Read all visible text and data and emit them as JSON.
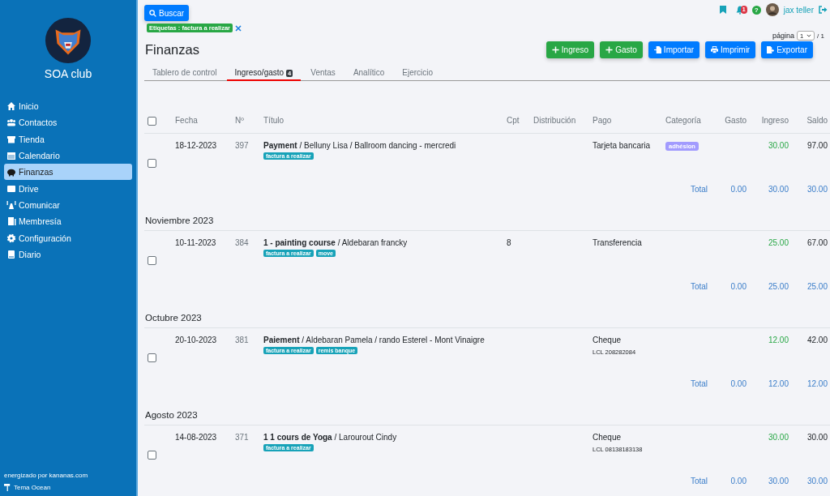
{
  "sidebar": {
    "club_name": "SOA club",
    "items": [
      {
        "label": "Inicio",
        "selected": false
      },
      {
        "label": "Contactos",
        "selected": false
      },
      {
        "label": "Tienda",
        "selected": false
      },
      {
        "label": "Calendario",
        "selected": false
      },
      {
        "label": "Finanzas",
        "selected": true
      },
      {
        "label": "Drive",
        "selected": false
      },
      {
        "label": "Comunicar",
        "selected": false
      },
      {
        "label": "Membresía",
        "selected": false
      },
      {
        "label": "Configuración",
        "selected": false
      },
      {
        "label": "Diario",
        "selected": false
      }
    ],
    "footer": "energizado por kananas.com",
    "theme": "Tema Ocean"
  },
  "topbar": {
    "search_button": "Buscar",
    "filter_chip": "Etiquetas : factura a realizar",
    "notifications": "1",
    "help": "?",
    "user": "jax teller"
  },
  "pagination": {
    "label": "página",
    "value": "1",
    "total": "/ 1"
  },
  "page_title": "Finanzas",
  "actions": [
    {
      "label": "Ingreso",
      "kind": "add"
    },
    {
      "label": "Gasto",
      "kind": "add"
    },
    {
      "label": "Importar",
      "kind": "import"
    },
    {
      "label": "Imprimir",
      "kind": "print"
    },
    {
      "label": "Exportar",
      "kind": "export"
    }
  ],
  "tabs": [
    {
      "label": "Tablero de control",
      "selected": false
    },
    {
      "label": "Ingreso/gasto",
      "badge": "4",
      "selected": true
    },
    {
      "label": "Ventas",
      "selected": false
    },
    {
      "label": "Analítico",
      "selected": false
    },
    {
      "label": "Ejercicio",
      "selected": false
    }
  ],
  "table": {
    "select_all_checked": false,
    "columns": [
      "Fecha",
      "Nº",
      "Título",
      "Cpt",
      "Distribución",
      "Pago",
      "Categoría",
      "Gasto",
      "Ingreso",
      "Saldo"
    ],
    "groups": [
      {
        "rows": [
          {
            "checked": false,
            "date": "18-12-2023",
            "number": "397",
            "title": "**Payment** / Belluny Lisa / Ballroom dancing - mercredi",
            "tags": [
              "factura a realizar"
            ],
            "pago": "Tarjeta bancaria",
            "categoria": {
              "label": "adhésion",
              "color": "#a29bfe"
            },
            "ingreso": "30.00",
            "saldo": "97.00"
          }
        ],
        "total": {
          "label": "Total",
          "gasto": "0.00",
          "ingreso": "30.00",
          "saldo": "30.00"
        }
      },
      {
        "heading": "Noviembre 2023",
        "rows": [
          {
            "checked": false,
            "date": "10-11-2023",
            "number": "384",
            "title": "**1 - painting course** / Aldebaran francky",
            "tags": [
              "factura a realizar",
              "move"
            ],
            "cpt": "8",
            "pago": "Transferencia",
            "ingreso": "25.00",
            "saldo": "67.00"
          }
        ],
        "total": {
          "label": "Total",
          "gasto": "0.00",
          "ingreso": "25.00",
          "saldo": "25.00"
        }
      },
      {
        "heading": "Octubre 2023",
        "rows": [
          {
            "checked": false,
            "date": "20-10-2023",
            "number": "381",
            "title": "**Paiement** / Aldebaran Pamela / rando Esterel - Mont Vinaigre",
            "tags": [
              "factura a realizar",
              "remis banque"
            ],
            "pago": "Cheque",
            "pago_detail": "LCL 208282084",
            "ingreso": "12.00",
            "saldo": "42.00"
          }
        ],
        "total": {
          "label": "Total",
          "gasto": "0.00",
          "ingreso": "12.00",
          "saldo": "12.00"
        }
      },
      {
        "heading": "Agosto 2023",
        "rows": [
          {
            "checked": false,
            "date": "14-08-2023",
            "number": "371",
            "title": "**1 1 cours de Yoga** / Larourout Cindy",
            "tags": [
              "factura a realizar"
            ],
            "pago": "Cheque",
            "pago_detail": "LCL 08138183138",
            "ingreso": "30.00",
            "saldo": "30.00"
          }
        ],
        "total": {
          "label": "Total",
          "gasto": "0.00",
          "ingreso": "30.00",
          "saldo": "30.00"
        }
      }
    ]
  }
}
